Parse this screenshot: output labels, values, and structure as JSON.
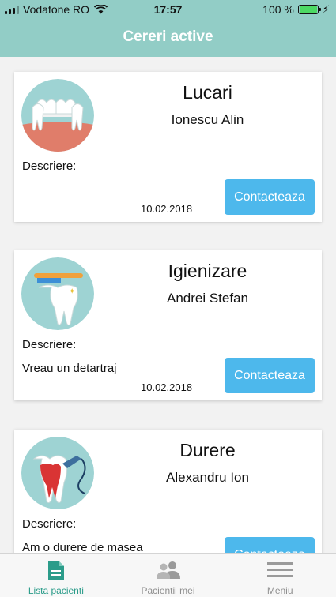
{
  "status_bar": {
    "carrier": "Vodafone RO",
    "time": "17:57",
    "battery": "100 %"
  },
  "header": {
    "title": "Cereri active"
  },
  "requests": [
    {
      "type": "Lucari",
      "patient": "Ionescu Alin",
      "description_label": "Descriere:",
      "description": "",
      "date": "10.02.2018",
      "contact_label": "Contacteaza",
      "image_icon": "dental-bridge-icon"
    },
    {
      "type": "Igienizare",
      "patient": "Andrei Stefan",
      "description_label": "Descriere:",
      "description": "Vreau un detartraj",
      "date": "10.02.2018",
      "contact_label": "Contacteaza",
      "image_icon": "toothbrush-tooth-icon"
    },
    {
      "type": "Durere",
      "patient": "Alexandru Ion",
      "description_label": "Descriere:",
      "description": "Am o durere de masea",
      "date": "",
      "contact_label": "Contacteaza",
      "image_icon": "dental-drill-icon"
    }
  ],
  "tab_bar": {
    "tabs": [
      {
        "label": "Lista pacienti",
        "icon": "document-icon",
        "active": true
      },
      {
        "label": "Pacientii mei",
        "icon": "people-icon",
        "active": false
      },
      {
        "label": "Meniu",
        "icon": "menu-icon",
        "active": false
      }
    ]
  },
  "colors": {
    "header": "#92cdc6",
    "accent_button": "#4db8ec",
    "active_tab": "#2b9c8a",
    "icon_circle": "#9ed3d3"
  }
}
